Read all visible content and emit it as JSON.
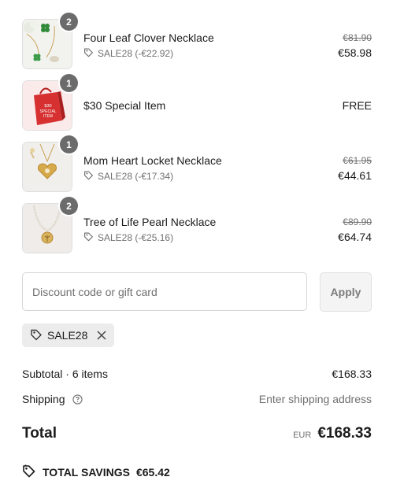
{
  "items": [
    {
      "name": "Four Leaf Clover Necklace",
      "qty": "2",
      "discount": "SALE28 (-€22.92)",
      "original_price": "€81.90",
      "price": "€58.98"
    },
    {
      "name": "$30 Special Item",
      "qty": "1",
      "price": "FREE",
      "bag_text": "$30 SPECIAL ITEM"
    },
    {
      "name": "Mom Heart Locket Necklace",
      "qty": "1",
      "discount": "SALE28 (-€17.34)",
      "original_price": "€61.95",
      "price": "€44.61"
    },
    {
      "name": "Tree of Life Pearl Necklace",
      "qty": "2",
      "discount": "SALE28 (-€25.16)",
      "original_price": "€89.90",
      "price": "€64.74"
    }
  ],
  "discount_form": {
    "placeholder": "Discount code or gift card",
    "apply_label": "Apply"
  },
  "applied_code": "SALE28",
  "summary": {
    "subtotal_label": "Subtotal · 6 items",
    "subtotal_value": "€168.33",
    "shipping_label": "Shipping",
    "shipping_value": "Enter shipping address",
    "total_label": "Total",
    "currency": "EUR",
    "total_value": "€168.33",
    "savings_label": "TOTAL SAVINGS",
    "savings_value": "€65.42"
  },
  "colors": {
    "badge": "#6b6b6b",
    "muted": "#707070",
    "chip_bg": "#ececec",
    "bag_red": "#d63031"
  }
}
